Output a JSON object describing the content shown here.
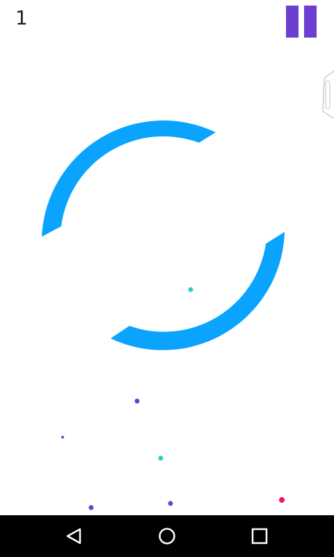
{
  "hud": {
    "score": "1"
  },
  "icons": {
    "pause": "pause-icon",
    "side_handle": "side-handle-icon",
    "back": "back-triangle-icon",
    "home": "home-circle-icon",
    "recent": "recent-apps-square-icon"
  },
  "colors": {
    "background": "#ffffff",
    "ring": "#0aa4ff",
    "pause": "#6c3fd1",
    "player": "#2bd0c8",
    "dot_purple": "#6c3fd1",
    "dot_teal": "#2bd0c8",
    "dot_pink": "#ff0a6c",
    "navbar": "#000000"
  }
}
